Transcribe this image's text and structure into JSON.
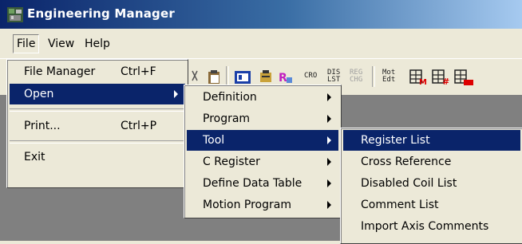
{
  "window": {
    "title": "Engineering Manager"
  },
  "menubar": {
    "items": [
      "File",
      "View",
      "Help"
    ]
  },
  "file_menu": {
    "items": [
      {
        "label": "File Manager",
        "accel": "Ctrl+F"
      },
      {
        "label": "Open"
      },
      {
        "label": "Print...",
        "accel": "Ctrl+P"
      },
      {
        "label": "Exit"
      }
    ]
  },
  "open_menu": {
    "items": [
      "Definition",
      "Program",
      "Tool",
      "C Register",
      "Define Data Table",
      "Motion Program"
    ]
  },
  "tool_menu": {
    "items": [
      "Register List",
      "Cross Reference",
      "Disabled Coil List",
      "Comment List",
      "Import Axis Comments"
    ]
  },
  "toolbar": {
    "cro": "CRO",
    "dis": "DIS",
    "lst": "LST",
    "reg": "REG",
    "chg": "CHG",
    "mot": "Mot",
    "edt": "Edt"
  },
  "colors": {
    "highlight": "#0a246a",
    "menu_bg": "#ece9d8",
    "workspace": "#808080"
  }
}
